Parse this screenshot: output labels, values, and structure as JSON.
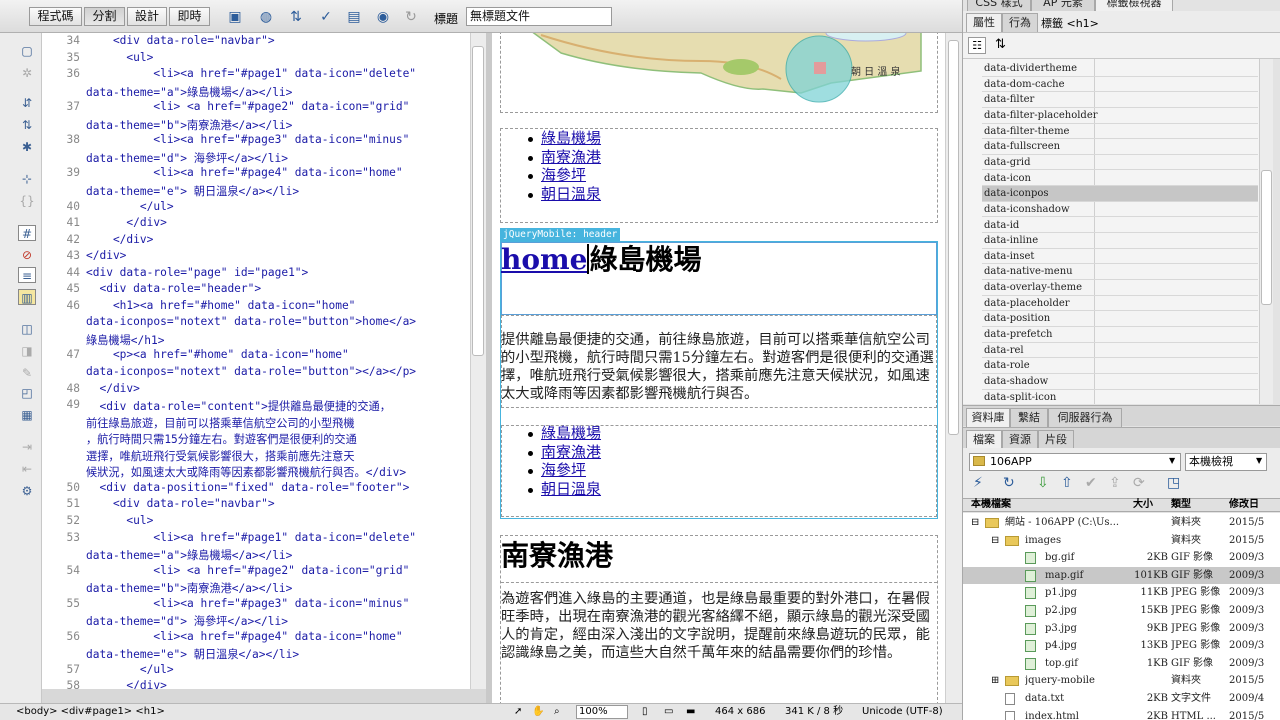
{
  "toolbar": {
    "code_btn": "程式碼",
    "split_btn": "分割",
    "design_btn": "設計",
    "live_btn": "即時",
    "title_label": "標題",
    "title_value": "無標題文件"
  },
  "code": {
    "lines": [
      {
        "n": "34",
        "t": "    <div data-role=\"navbar\">"
      },
      {
        "n": "35",
        "t": "      <ul>"
      },
      {
        "n": "36",
        "t": "          <li><a href=\"#page1\" data-icon=\"delete\""
      },
      {
        "n": "",
        "t": "data-theme=\"a\">綠島機場</a></li>"
      },
      {
        "n": "37",
        "t": "          <li> <a href=\"#page2\" data-icon=\"grid\""
      },
      {
        "n": "",
        "t": "data-theme=\"b\">南寮漁港</a></li>"
      },
      {
        "n": "38",
        "t": "          <li><a href=\"#page3\" data-icon=\"minus\""
      },
      {
        "n": "",
        "t": "data-theme=\"d\"> 海參坪</a></li>"
      },
      {
        "n": "39",
        "t": "          <li><a href=\"#page4\" data-icon=\"home\""
      },
      {
        "n": "",
        "t": "data-theme=\"e\"> 朝日溫泉</a></li>"
      },
      {
        "n": "40",
        "t": "        </ul>"
      },
      {
        "n": "41",
        "t": "      </div>"
      },
      {
        "n": "42",
        "t": "    </div>"
      },
      {
        "n": "43",
        "t": "</div>"
      },
      {
        "n": "44",
        "t": "<div data-role=\"page\" id=\"page1\">"
      },
      {
        "n": "45",
        "t": "  <div data-role=\"header\">"
      },
      {
        "n": "46",
        "t": "    <h1><a href=\"#home\" data-icon=\"home\""
      },
      {
        "n": "",
        "t": "data-iconpos=\"notext\" data-role=\"button\">home</a>"
      },
      {
        "n": "",
        "t": "綠島機場</h1>"
      },
      {
        "n": "47",
        "t": "    <p><a href=\"#home\" data-icon=\"home\""
      },
      {
        "n": "",
        "t": "data-iconpos=\"notext\" data-role=\"button\"></a></p>"
      },
      {
        "n": "48",
        "t": "  </div>"
      },
      {
        "n": "49",
        "t": "  <div data-role=\"content\">提供離島最便捷的交通，"
      },
      {
        "n": "",
        "t": "前往綠島旅遊，目前可以搭乘華信航空公司的小型飛機"
      },
      {
        "n": "",
        "t": "，航行時間只需15分鐘左右。對遊客們是很便利的交通"
      },
      {
        "n": "",
        "t": "選擇，唯航班飛行受氣候影響很大，搭乘前應先注意天"
      },
      {
        "n": "",
        "t": "候狀況，如風速太大或降雨等因素都影響飛機航行與否。</div>"
      },
      {
        "n": "50",
        "t": "  <div data-position=\"fixed\" data-role=\"footer\">"
      },
      {
        "n": "51",
        "t": "    <div data-role=\"navbar\">"
      },
      {
        "n": "52",
        "t": "      <ul>"
      },
      {
        "n": "53",
        "t": "          <li><a href=\"#page1\" data-icon=\"delete\""
      },
      {
        "n": "",
        "t": "data-theme=\"a\">綠島機場</a></li>"
      },
      {
        "n": "54",
        "t": "          <li> <a href=\"#page2\" data-icon=\"grid\""
      },
      {
        "n": "",
        "t": "data-theme=\"b\">南寮漁港</a></li>"
      },
      {
        "n": "55",
        "t": "          <li><a href=\"#page3\" data-icon=\"minus\""
      },
      {
        "n": "",
        "t": "data-theme=\"d\"> 海參坪</a></li>"
      },
      {
        "n": "56",
        "t": "          <li><a href=\"#page4\" data-icon=\"home\""
      },
      {
        "n": "",
        "t": "data-theme=\"e\"> 朝日溫泉</a></li>"
      },
      {
        "n": "57",
        "t": "        </ul>"
      },
      {
        "n": "58",
        "t": "      </div>"
      }
    ]
  },
  "design": {
    "nav1": [
      "綠島機場",
      "南寮漁港",
      "海參坪",
      "朝日溫泉"
    ],
    "header_tag": "jQueryMobile: header",
    "home_link": "home",
    "h1_text": "綠島機場",
    "para1": "提供離島最便捷的交通，前往綠島旅遊，目前可以搭乘華信航空公司的小型飛機，航行時間只需15分鐘左右。對遊客們是很便利的交通選擇，唯航班飛行受氣候影響很大，搭乘前應先注意天候狀況，如風速太大或降雨等因素都影響飛機航行與否。",
    "nav2": [
      "綠島機場",
      "南寮漁港",
      "海參坪",
      "朝日溫泉"
    ],
    "h1_2": "南寮漁港",
    "para2": "為遊客們進入綠島的主要通道，也是綠島最重要的對外港口，在暑假旺季時，出現在南寮漁港的觀光客絡繹不絕，顯示綠島的觀光深受國人的肯定，經由深入淺出的文字說明，提醒前來綠島遊玩的民眾，能認識綠島之美，而這些大自然千萬年來的結晶需要你們的珍惜。",
    "map_text": "朝 日 溫 泉"
  },
  "status": {
    "breadcrumb": "<body> <div#page1> <h1>",
    "zoom": "100%",
    "size": "464 x 686",
    "filesize": "341 K / 8 秒",
    "encoding": "Unicode (UTF-8)"
  },
  "panel": {
    "top_tabs": [
      "CSS 樣式",
      "AP 元素",
      "標籤檢視器"
    ],
    "sub_tabs": [
      "屬性",
      "行為"
    ],
    "tag_label": "標籤 <h1>",
    "props": [
      "data-dividertheme",
      "data-dom-cache",
      "data-filter",
      "data-filter-placeholder",
      "data-filter-theme",
      "data-fullscreen",
      "data-grid",
      "data-icon",
      "data-iconpos",
      "data-iconshadow",
      "data-id",
      "data-inline",
      "data-inset",
      "data-native-menu",
      "data-overlay-theme",
      "data-placeholder",
      "data-position",
      "data-prefetch",
      "data-rel",
      "data-role",
      "data-shadow",
      "data-split-icon"
    ],
    "selected_prop": "data-iconpos",
    "mid_tabs": [
      "資料庫",
      "繫結",
      "伺服器行為"
    ],
    "file_tabs": [
      "檔案",
      "資源",
      "片段"
    ],
    "site_select": "106APP",
    "view_select": "本機檢視",
    "file_headers": [
      "本機檔案",
      "大小",
      "類型",
      "修改日"
    ],
    "files": [
      {
        "indent": 0,
        "exp": "⊟",
        "icon": "folder",
        "name": "網站 - 106APP (C:\\Us...",
        "size": "",
        "type": "資料夾",
        "date": "2015/5"
      },
      {
        "indent": 1,
        "exp": "⊟",
        "icon": "folder",
        "name": "images",
        "size": "",
        "type": "資料夾",
        "date": "2015/5"
      },
      {
        "indent": 2,
        "exp": "",
        "icon": "img",
        "name": "bg.gif",
        "size": "2KB",
        "type": "GIF 影像",
        "date": "2009/3"
      },
      {
        "indent": 2,
        "exp": "",
        "icon": "img",
        "name": "map.gif",
        "size": "101KB",
        "type": "GIF 影像",
        "date": "2009/3",
        "sel": true
      },
      {
        "indent": 2,
        "exp": "",
        "icon": "img",
        "name": "p1.jpg",
        "size": "11KB",
        "type": "JPEG 影像",
        "date": "2009/3"
      },
      {
        "indent": 2,
        "exp": "",
        "icon": "img",
        "name": "p2.jpg",
        "size": "15KB",
        "type": "JPEG 影像",
        "date": "2009/3"
      },
      {
        "indent": 2,
        "exp": "",
        "icon": "img",
        "name": "p3.jpg",
        "size": "9KB",
        "type": "JPEG 影像",
        "date": "2009/3"
      },
      {
        "indent": 2,
        "exp": "",
        "icon": "img",
        "name": "p4.jpg",
        "size": "13KB",
        "type": "JPEG 影像",
        "date": "2009/3"
      },
      {
        "indent": 2,
        "exp": "",
        "icon": "img",
        "name": "top.gif",
        "size": "1KB",
        "type": "GIF 影像",
        "date": "2009/3"
      },
      {
        "indent": 1,
        "exp": "⊞",
        "icon": "folder",
        "name": "jquery-mobile",
        "size": "",
        "type": "資料夾",
        "date": "2015/5"
      },
      {
        "indent": 1,
        "exp": "",
        "icon": "doc",
        "name": "data.txt",
        "size": "2KB",
        "type": "文字文件",
        "date": "2009/4"
      },
      {
        "indent": 1,
        "exp": "",
        "icon": "doc",
        "name": "index.html",
        "size": "2KB",
        "type": "HTML ...",
        "date": "2015/5"
      }
    ]
  },
  "colors": {
    "link": "#1a0dab",
    "tag_badge": "#46b4de",
    "selection": "#c6c6c6",
    "map_land": "#e6ddb0",
    "map_sea": "#7fd3d6"
  }
}
